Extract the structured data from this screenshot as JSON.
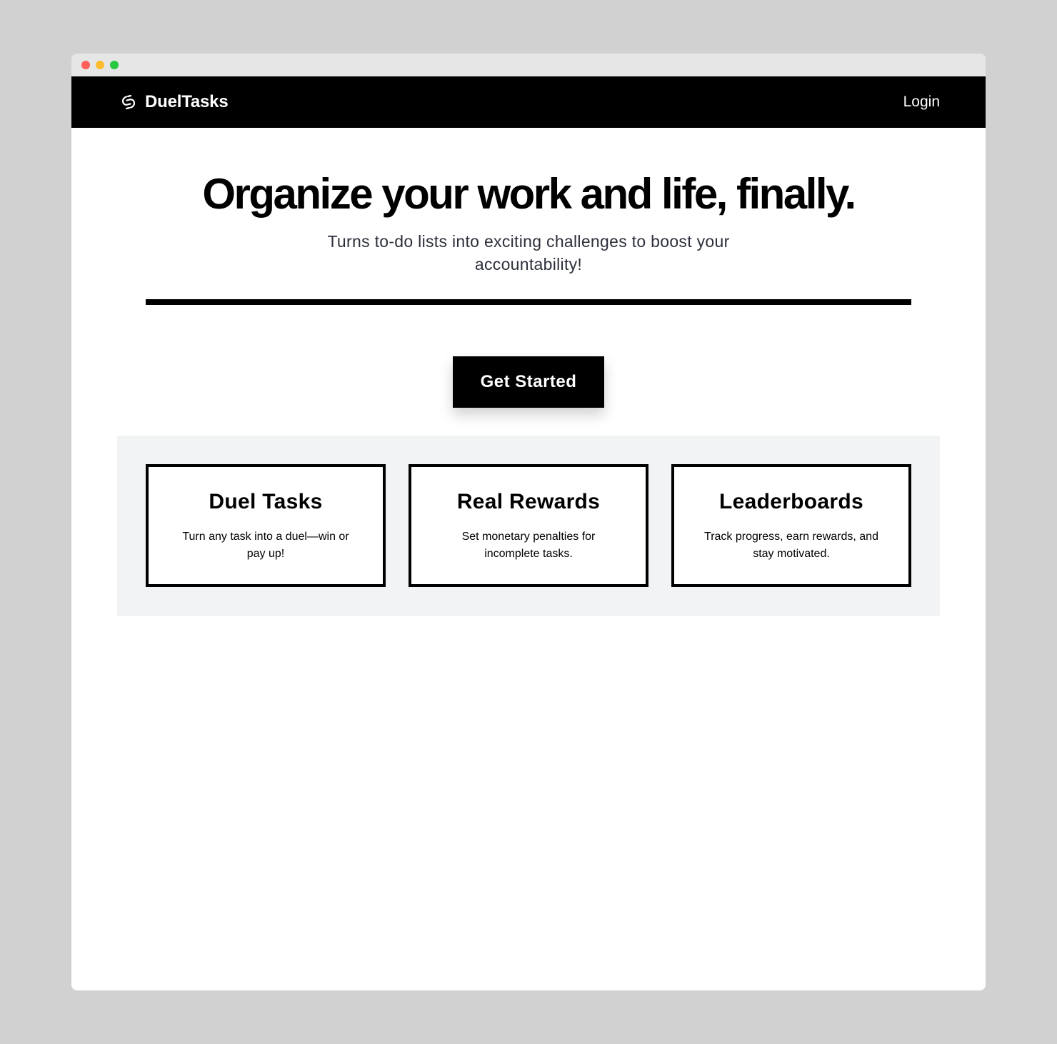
{
  "brand": {
    "name": "DuelTasks",
    "icon": "linked-swirl-logo"
  },
  "nav": {
    "login_label": "Login"
  },
  "hero": {
    "title": "Organize your work and life, finally.",
    "subtitle": "Turns to-do lists into exciting challenges to boost your accountability!",
    "cta_label": "Get Started"
  },
  "features": [
    {
      "title": "Duel Tasks",
      "description": "Turn any task into a duel—win or pay up!"
    },
    {
      "title": "Real Rewards",
      "description": "Set monetary penalties for incomplete tasks."
    },
    {
      "title": "Leaderboards",
      "description": "Track progress, earn rewards, and stay motivated."
    }
  ],
  "colors": {
    "nav_bg": "#000000",
    "page_bg": "#ffffff",
    "features_bg": "#f2f3f5",
    "desktop_bg": "#d1d1d1"
  }
}
